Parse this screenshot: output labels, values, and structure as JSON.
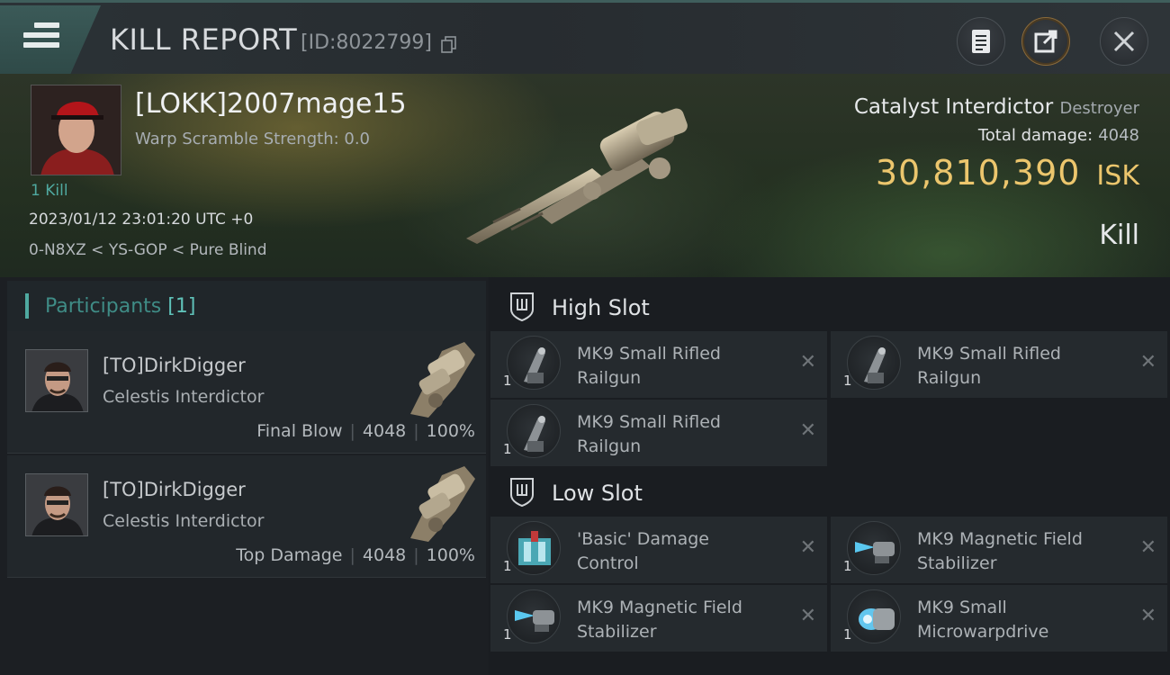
{
  "header": {
    "title": "KILL REPORT",
    "report_id": "[ID:8022799]"
  },
  "victim": {
    "name": "[LOKK]2007mage15",
    "warp_scramble": "Warp Scramble Strength: 0.0",
    "kill_count": "1 Kill",
    "datetime": "2023/01/12 23:01:20 UTC +0",
    "location": "0-N8XZ < YS-GOP < Pure Blind",
    "ship_name": "Catalyst Interdictor",
    "ship_class": "Destroyer",
    "total_damage_label": "Total damage:",
    "total_damage": "4048",
    "isk_value": "30,810,390",
    "isk_unit": "ISK",
    "kill_type": "Kill"
  },
  "participants": {
    "label": "Participants",
    "count": "[1]",
    "items": [
      {
        "name": "[TO]DirkDigger",
        "ship": "Celestis Interdictor",
        "role": "Final Blow",
        "damage": "4048",
        "percent": "100%"
      },
      {
        "name": "[TO]DirkDigger",
        "ship": "Celestis Interdictor",
        "role": "Top Damage",
        "damage": "4048",
        "percent": "100%"
      }
    ]
  },
  "slots": {
    "high": {
      "label": "High Slot",
      "modules": [
        {
          "qty": "1",
          "line1": "MK9 Small Rifled",
          "line2": "Railgun"
        },
        {
          "qty": "1",
          "line1": "MK9 Small Rifled",
          "line2": "Railgun"
        },
        {
          "qty": "1",
          "line1": "MK9 Small Rifled",
          "line2": "Railgun"
        }
      ]
    },
    "low": {
      "label": "Low Slot",
      "modules": [
        {
          "qty": "1",
          "line1": "'Basic' Damage",
          "line2": "Control"
        },
        {
          "qty": "1",
          "line1": "MK9 Magnetic Field",
          "line2": "Stabilizer"
        },
        {
          "qty": "1",
          "line1": "MK9 Magnetic Field",
          "line2": "Stabilizer"
        },
        {
          "qty": "1",
          "line1": "MK9 Small",
          "line2": "Microwarpdrive"
        }
      ]
    }
  },
  "icons": {
    "remove": "✕"
  },
  "colors": {
    "accent_teal": "#4fa9a0",
    "isk_gold": "#ecc66d"
  }
}
